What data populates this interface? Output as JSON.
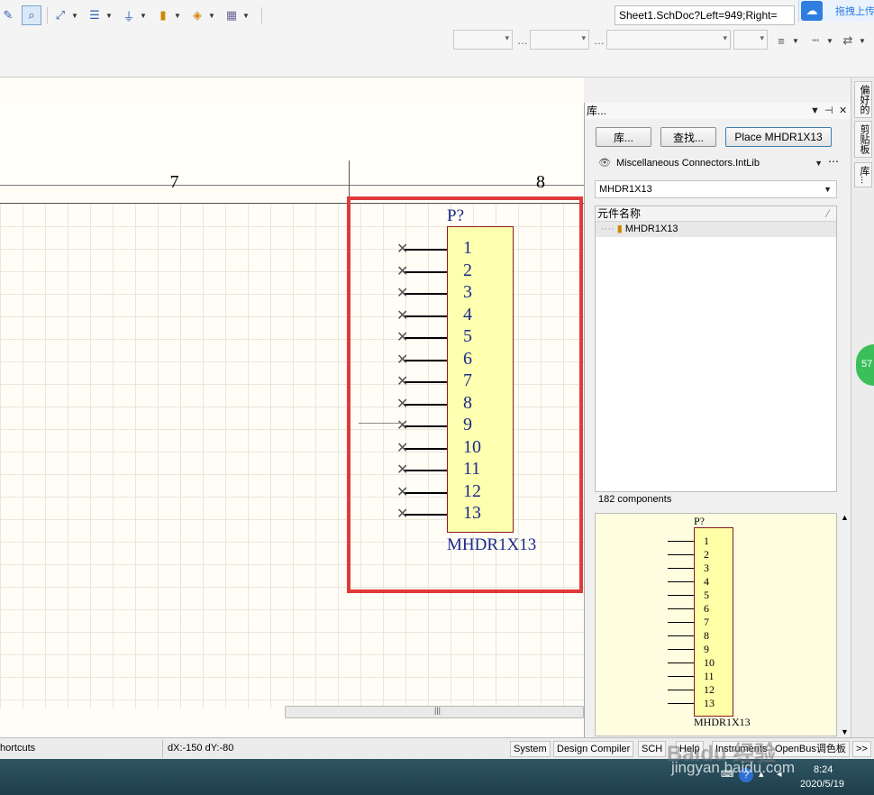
{
  "toolbar": {
    "document_combo": "Sheet1.SchDoc?Left=949;Right=",
    "baidu_label": "拖拽上传"
  },
  "canvas": {
    "zone_left": "7",
    "zone_right": "8"
  },
  "component": {
    "designator": "P?",
    "pins": [
      "1",
      "2",
      "3",
      "4",
      "5",
      "6",
      "7",
      "8",
      "9",
      "10",
      "11",
      "12",
      "13"
    ],
    "name": "MHDR1X13"
  },
  "library_panel": {
    "title": "库...",
    "btn_library": "库...",
    "btn_search": "查找...",
    "btn_place": "Place MHDR1X13",
    "library_name": "Miscellaneous Connectors.IntLib",
    "filter_value": "MHDR1X13",
    "list_header": "元件名称",
    "list_items": [
      "MHDR1X13"
    ],
    "component_count": "182 components",
    "preview_designator": "P?",
    "preview_name": "MHDR1X13"
  },
  "dock": {
    "tabs": [
      "偏好的",
      "剪贴板",
      "库..."
    ],
    "badge": "57"
  },
  "statusbar": {
    "shortcuts": "hortcuts",
    "delta": "dX:-150 dY:-80",
    "buttons": [
      "System",
      "Design Compiler",
      "SCH",
      "Help",
      "Instruments",
      "OpenBus调色板",
      ">>"
    ]
  },
  "taskbar": {
    "time": "8:24",
    "date": "2020/5/19"
  },
  "watermark": {
    "brand": "Baidu 经验",
    "url": "jingyan.baidu.com"
  },
  "colors": {
    "highlight": "#e03a3a",
    "component_fill": "#ffffb0",
    "text_blue": "#1b2a8a"
  }
}
